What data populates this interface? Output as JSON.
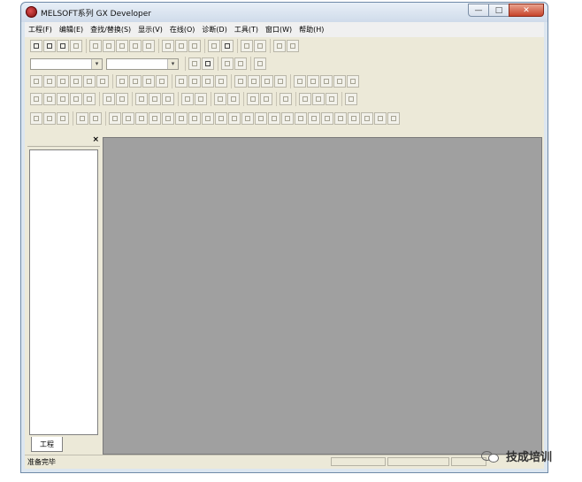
{
  "window": {
    "title": "MELSOFT系列 GX Developer"
  },
  "window_controls": {
    "minimize": "—",
    "maximize": "□",
    "close": "✕"
  },
  "menu": [
    "工程(F)",
    "编辑(E)",
    "查找/替换(S)",
    "显示(V)",
    "在线(O)",
    "诊断(D)",
    "工具(T)",
    "窗口(W)",
    "帮助(H)"
  ],
  "left_panel": {
    "close_glyph": "×",
    "tab_label": "工程"
  },
  "status": {
    "text": "准备完毕"
  },
  "watermark": {
    "text": "技成培训"
  },
  "icons": {
    "app": "melsoft-app-icon",
    "watermark": "wechat-icon"
  }
}
